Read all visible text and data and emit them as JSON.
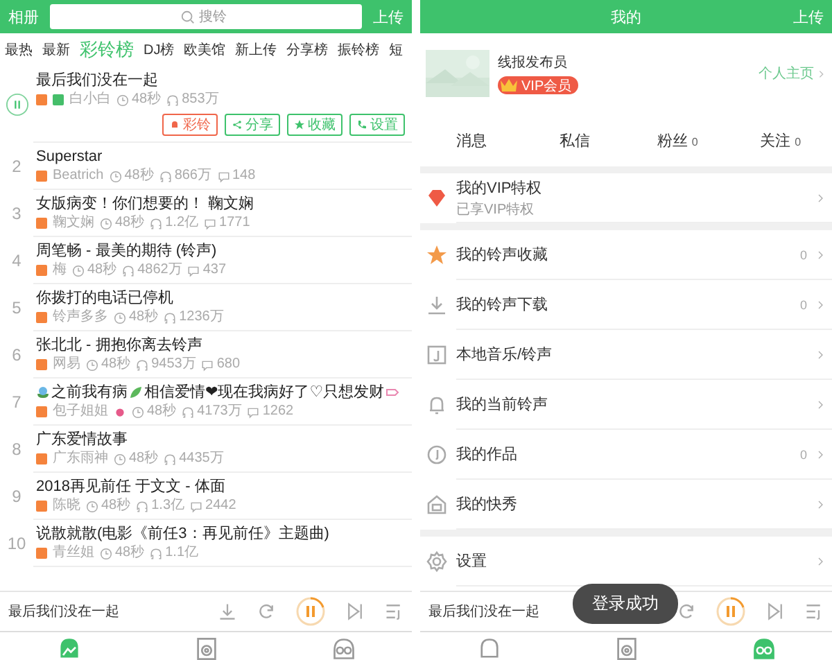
{
  "left": {
    "header": {
      "left_label": "相册",
      "search": {
        "placeholder": "搜铃"
      },
      "right_label": "上传"
    },
    "tabs": [
      {
        "label": "最热",
        "selected": false
      },
      {
        "label": "最新",
        "selected": false
      },
      {
        "label": "彩铃榜",
        "selected": true
      },
      {
        "label": "DJ榜",
        "selected": false
      },
      {
        "label": "欧美馆",
        "selected": false
      },
      {
        "label": "新上传",
        "selected": false
      },
      {
        "label": "分享榜",
        "selected": false
      },
      {
        "label": "振铃榜",
        "selected": false
      },
      {
        "label": "短",
        "selected": false
      }
    ],
    "songs": [
      {
        "kind": "plain",
        "playing": true,
        "expanded": true,
        "title": "最后我们没在一起",
        "badges": [
          {
            "color": "#f5833c"
          },
          {
            "color": "#45be6a"
          }
        ],
        "uploader": "白小白",
        "duration": "48秒",
        "plays": "853万",
        "actions": [
          {
            "kind": "ringback",
            "label": "彩铃"
          },
          {
            "kind": "share",
            "label": "分享"
          },
          {
            "kind": "favorite",
            "label": "收藏"
          },
          {
            "kind": "phone",
            "label": "设置"
          }
        ]
      },
      {
        "kind": "plain",
        "playing": false,
        "expanded": false,
        "rank": "2",
        "title": "Superstar",
        "badges": [
          {
            "color": "#f5833c"
          }
        ],
        "uploader": "Beatrich",
        "duration": "48秒",
        "plays": "866万",
        "comments": "148"
      },
      {
        "kind": "plain",
        "playing": false,
        "expanded": false,
        "rank": "3",
        "title": "女版病变！你们想要的！ 鞠文娴",
        "badges": [
          {
            "color": "#f5833c"
          }
        ],
        "uploader": "鞠文娴",
        "duration": "48秒",
        "plays": "1.2亿",
        "comments": "1771"
      },
      {
        "kind": "plain",
        "playing": false,
        "expanded": false,
        "rank": "4",
        "title": "周笔畅 - 最美的期待 (铃声)",
        "badges": [
          {
            "color": "#f5833c"
          }
        ],
        "uploader": "梅",
        "duration": "48秒",
        "plays": "4862万",
        "comments": "437"
      },
      {
        "kind": "plain",
        "playing": false,
        "expanded": false,
        "rank": "5",
        "title": "你拨打的电话已停机",
        "badges": [
          {
            "color": "#f5833c"
          }
        ],
        "uploader": "铃声多多",
        "duration": "48秒",
        "plays": "1236万"
      },
      {
        "kind": "plain",
        "playing": false,
        "expanded": false,
        "rank": "6",
        "title": "张北北 - 拥抱你离去铃声",
        "badges": [
          {
            "color": "#f5833c"
          }
        ],
        "uploader": "网易",
        "duration": "48秒",
        "plays": "9453万",
        "comments": "680"
      },
      {
        "kind": "decorated",
        "playing": false,
        "expanded": false,
        "rank": "7",
        "title_parts": [
          "之前我有病",
          "相信爱情❤现在我病好了♡只想发财"
        ],
        "badges": [
          {
            "color": "#f5833c"
          }
        ],
        "uploader": "包子姐姐",
        "duration": "48秒",
        "plays": "4173万",
        "comments": "1262"
      },
      {
        "kind": "plain",
        "playing": false,
        "expanded": false,
        "rank": "8",
        "title": "广东爱情故事",
        "badges": [
          {
            "color": "#f5833c"
          }
        ],
        "uploader": "广东雨神",
        "duration": "48秒",
        "plays": "4435万"
      },
      {
        "kind": "plain",
        "playing": false,
        "expanded": false,
        "rank": "9",
        "title": "2018再见前任  于文文 - 体面",
        "badges": [
          {
            "color": "#f5833c"
          }
        ],
        "uploader": "陈晓",
        "duration": "48秒",
        "plays": "1.3亿",
        "comments": "2442"
      },
      {
        "kind": "plain",
        "playing": false,
        "expanded": false,
        "rank": "10",
        "title": "说散就散(电影《前任3：再见前任》主题曲)",
        "badges": [
          {
            "color": "#f5833c"
          }
        ],
        "uploader": "青丝姐",
        "duration": "48秒",
        "plays": "1.1亿"
      }
    ],
    "player": {
      "title": "最后我们没在一起"
    },
    "nav": [
      {
        "selected": true
      },
      {
        "selected": false
      },
      {
        "selected": false
      }
    ]
  },
  "right": {
    "header": {
      "title": "我的",
      "right_label": "上传"
    },
    "profile": {
      "name": "线报发布员",
      "badge": "VIP会员",
      "link": "个人主页"
    },
    "stats": [
      {
        "label": "消息"
      },
      {
        "label": "私信"
      },
      {
        "label": "粉丝",
        "count": "0"
      },
      {
        "label": "关注",
        "count": "0"
      }
    ],
    "menu_groups": [
      [
        {
          "label": "我的VIP特权",
          "subtitle": "已享VIP特权"
        }
      ],
      [
        {
          "label": "我的铃声收藏",
          "count": "0"
        },
        {
          "label": "我的铃声下载",
          "count": "0"
        },
        {
          "label": "本地音乐/铃声"
        },
        {
          "label": "我的当前铃声"
        },
        {
          "label": "我的作品",
          "count": "0"
        },
        {
          "label": "我的快秀"
        }
      ],
      [
        {
          "label": "设置"
        }
      ]
    ],
    "player": {
      "title": "最后我们没在一起"
    },
    "toast": "登录成功",
    "nav": [
      {
        "selected": false
      },
      {
        "selected": false
      },
      {
        "selected": true
      }
    ]
  }
}
